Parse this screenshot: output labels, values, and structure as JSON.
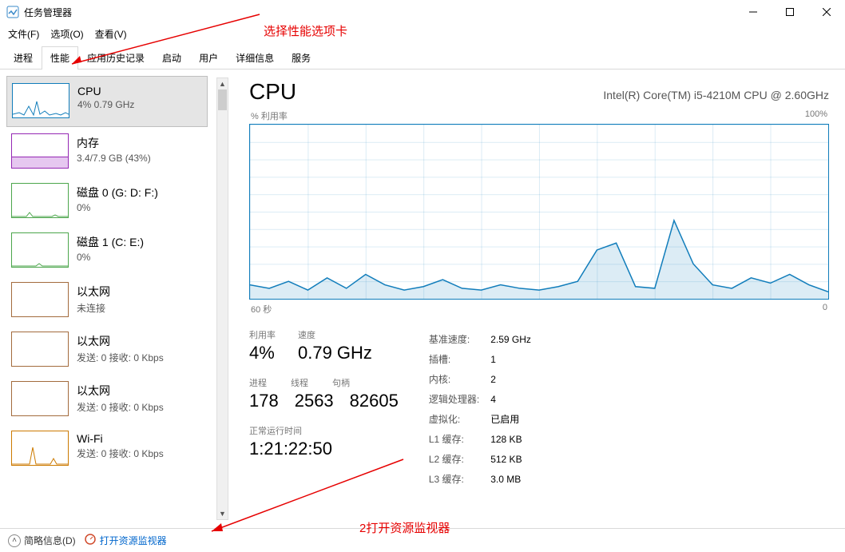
{
  "window": {
    "title": "任务管理器"
  },
  "menu": {
    "file": "文件(F)",
    "options": "选项(O)",
    "view": "查看(V)"
  },
  "tabs": {
    "processes": "进程",
    "performance": "性能",
    "app_history": "应用历史记录",
    "startup": "启动",
    "users": "用户",
    "details": "详细信息",
    "services": "服务"
  },
  "sidebar": {
    "items": [
      {
        "name": "CPU",
        "sub": "4% 0.79 GHz"
      },
      {
        "name": "内存",
        "sub": "3.4/7.9 GB (43%)"
      },
      {
        "name": "磁盘 0 (G: D: F:)",
        "sub": "0%"
      },
      {
        "name": "磁盘 1 (C: E:)",
        "sub": "0%"
      },
      {
        "name": "以太网",
        "sub": "未连接"
      },
      {
        "name": "以太网",
        "sub": "发送: 0 接收: 0 Kbps"
      },
      {
        "name": "以太网",
        "sub": "发送: 0 接收: 0 Kbps"
      },
      {
        "name": "Wi-Fi",
        "sub": "发送: 0 接收: 0 Kbps"
      }
    ]
  },
  "main": {
    "title": "CPU",
    "model": "Intel(R) Core(TM) i5-4210M CPU @ 2.60GHz",
    "chart": {
      "y_label": "% 利用率",
      "y_max": "100%",
      "x_left": "60 秒",
      "x_right": "0"
    },
    "stats_left": {
      "util_label": "利用率",
      "util": "4%",
      "speed_label": "速度",
      "speed": "0.79 GHz",
      "proc_label": "进程",
      "proc": "178",
      "thread_label": "线程",
      "thread": "2563",
      "handle_label": "句柄",
      "handle": "82605",
      "uptime_label": "正常运行时间",
      "uptime": "1:21:22:50"
    },
    "stats_right": {
      "base_speed_label": "基准速度:",
      "base_speed": "2.59 GHz",
      "sockets_label": "插槽:",
      "sockets": "1",
      "cores_label": "内核:",
      "cores": "2",
      "lprocs_label": "逻辑处理器:",
      "lprocs": "4",
      "virt_label": "虚拟化:",
      "virt": "已启用",
      "l1_label": "L1 缓存:",
      "l1": "128 KB",
      "l2_label": "L2 缓存:",
      "l2": "512 KB",
      "l3_label": "L3 缓存:",
      "l3": "3.0 MB"
    }
  },
  "footer": {
    "brief": "简略信息(D)",
    "rmon": "打开资源监视器"
  },
  "annotations": {
    "a1": "选择性能选项卡",
    "a2": "2打开资源监视器"
  },
  "chart_data": {
    "type": "line",
    "title": "CPU % 利用率",
    "xlabel": "秒",
    "ylabel": "% 利用率",
    "ylim": [
      0,
      100
    ],
    "xlim": [
      60,
      0
    ],
    "x": [
      60,
      58,
      56,
      54,
      52,
      50,
      48,
      46,
      44,
      42,
      40,
      38,
      36,
      34,
      32,
      30,
      28,
      26,
      24,
      22,
      20,
      18,
      16,
      14,
      12,
      10,
      8,
      6,
      4,
      2,
      0
    ],
    "values": [
      8,
      6,
      10,
      5,
      12,
      6,
      14,
      8,
      5,
      7,
      11,
      6,
      5,
      8,
      6,
      5,
      7,
      10,
      28,
      32,
      7,
      6,
      45,
      20,
      8,
      6,
      12,
      9,
      14,
      8,
      4
    ]
  }
}
